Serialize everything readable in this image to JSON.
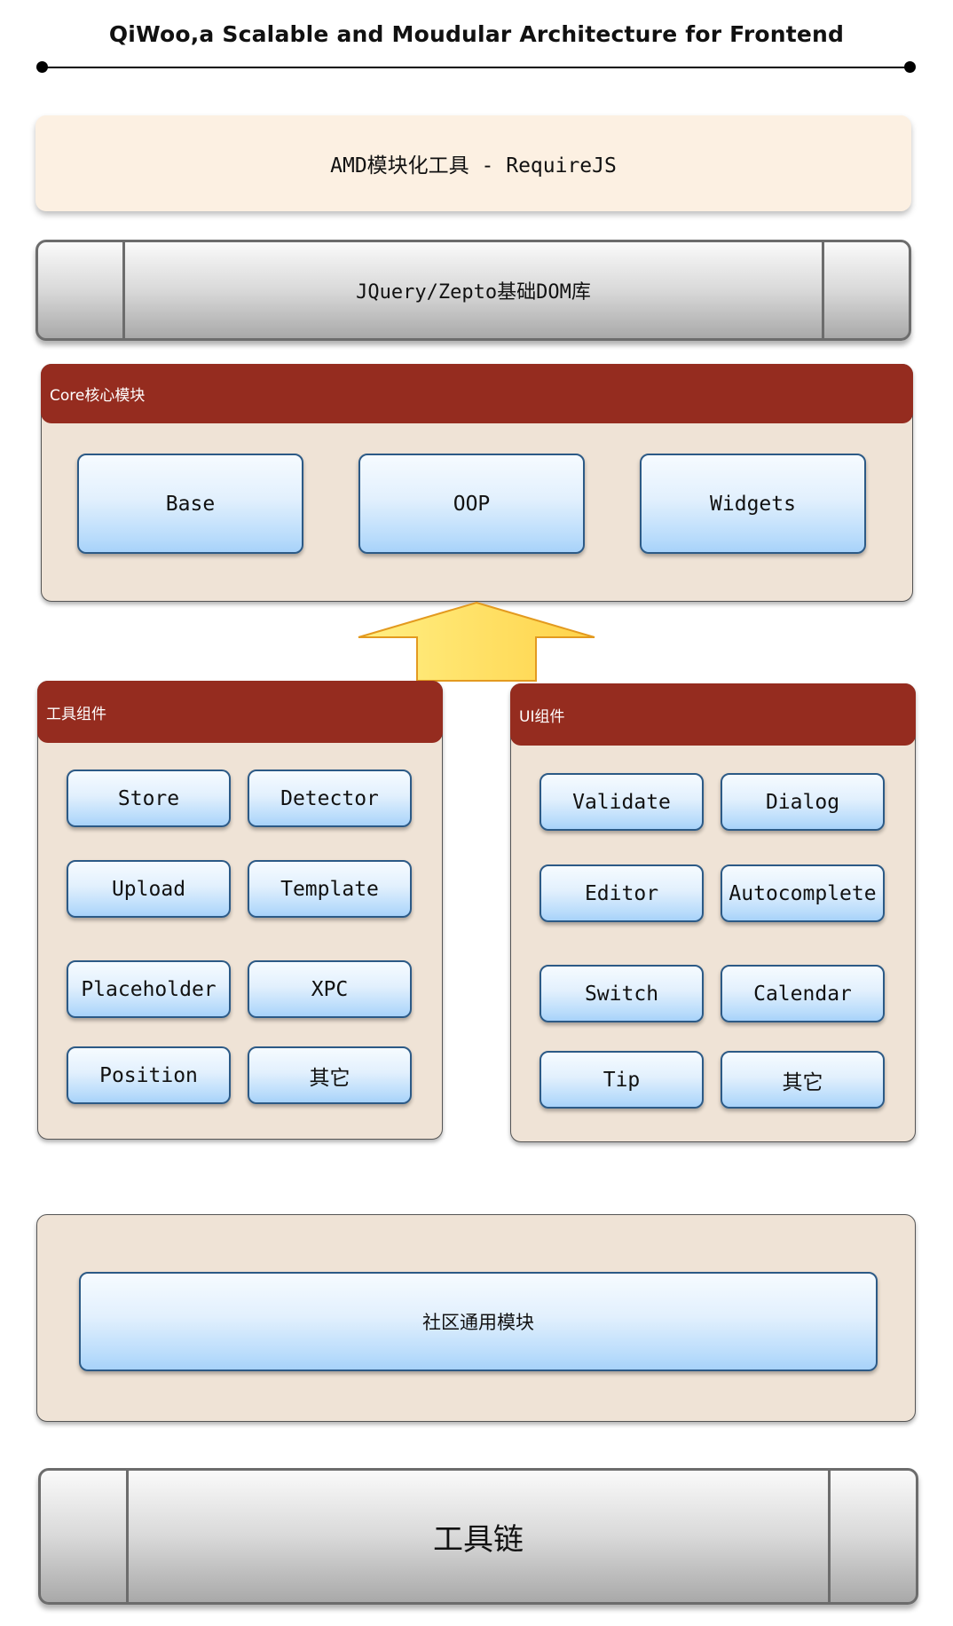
{
  "title": "QiWoo,a Scalable and Moudular Architecture for Frontend",
  "amd_layer": "AMD模块化工具 - RequireJS",
  "dom_layer": "JQuery/Zepto基础DOM库",
  "core": {
    "header": "Core核心模块",
    "items": [
      "Base",
      "OOP",
      "Widgets"
    ]
  },
  "tools": {
    "header": "工具组件",
    "items": [
      "Store",
      "Detector",
      "Upload",
      "Template",
      "Placeholder",
      "XPC",
      "Position",
      "其它"
    ]
  },
  "ui": {
    "header": "UI组件",
    "items": [
      "Validate",
      "Dialog",
      "Editor",
      "Autocomplete",
      "Switch",
      "Calendar",
      "Tip",
      "其它"
    ]
  },
  "community": "社区通用模块",
  "toolchain": "工具链",
  "colors": {
    "header_red": "#952c1f",
    "panel_beige": "#efe3d6",
    "button_blue": "#a7d2fa",
    "arrow_yellow": "#ffe066",
    "amd_bg": "#fcf0e2"
  }
}
